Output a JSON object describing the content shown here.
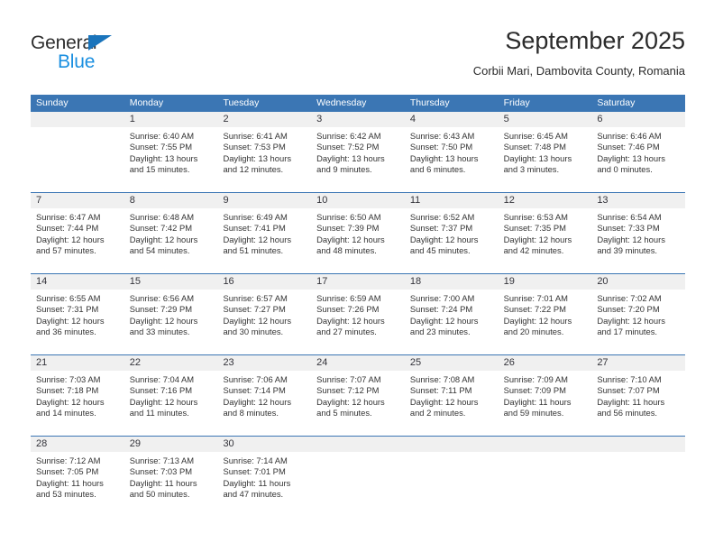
{
  "brand": {
    "name_part1": "General",
    "name_part2": "Blue",
    "color_dark": "#2e2e2e",
    "color_blue": "#1a8fe0",
    "triangle_color": "#1a74bb"
  },
  "header": {
    "title": "September 2025",
    "subtitle": "Corbii Mari, Dambovita County, Romania"
  },
  "theme": {
    "header_row_bg": "#3b76b4",
    "header_row_text": "#ffffff",
    "daynum_band_bg": "#f0f0f0",
    "cell_bg": "#ffffff",
    "text": "#333333"
  },
  "weekdays": [
    "Sunday",
    "Monday",
    "Tuesday",
    "Wednesday",
    "Thursday",
    "Friday",
    "Saturday"
  ],
  "labels": {
    "sunrise_prefix": "Sunrise:",
    "sunset_prefix": "Sunset:",
    "daylight_prefix": "Daylight:"
  },
  "weeks": [
    {
      "days": [
        {
          "num": "",
          "empty": true,
          "l1": "",
          "l2": "",
          "l3": "",
          "l4": ""
        },
        {
          "num": "1",
          "empty": false,
          "l1": "Sunrise: 6:40 AM",
          "l2": "Sunset: 7:55 PM",
          "l3": "Daylight: 13 hours",
          "l4": "and 15 minutes."
        },
        {
          "num": "2",
          "empty": false,
          "l1": "Sunrise: 6:41 AM",
          "l2": "Sunset: 7:53 PM",
          "l3": "Daylight: 13 hours",
          "l4": "and 12 minutes."
        },
        {
          "num": "3",
          "empty": false,
          "l1": "Sunrise: 6:42 AM",
          "l2": "Sunset: 7:52 PM",
          "l3": "Daylight: 13 hours",
          "l4": "and 9 minutes."
        },
        {
          "num": "4",
          "empty": false,
          "l1": "Sunrise: 6:43 AM",
          "l2": "Sunset: 7:50 PM",
          "l3": "Daylight: 13 hours",
          "l4": "and 6 minutes."
        },
        {
          "num": "5",
          "empty": false,
          "l1": "Sunrise: 6:45 AM",
          "l2": "Sunset: 7:48 PM",
          "l3": "Daylight: 13 hours",
          "l4": "and 3 minutes."
        },
        {
          "num": "6",
          "empty": false,
          "l1": "Sunrise: 6:46 AM",
          "l2": "Sunset: 7:46 PM",
          "l3": "Daylight: 13 hours",
          "l4": "and 0 minutes."
        }
      ]
    },
    {
      "days": [
        {
          "num": "7",
          "empty": false,
          "l1": "Sunrise: 6:47 AM",
          "l2": "Sunset: 7:44 PM",
          "l3": "Daylight: 12 hours",
          "l4": "and 57 minutes."
        },
        {
          "num": "8",
          "empty": false,
          "l1": "Sunrise: 6:48 AM",
          "l2": "Sunset: 7:42 PM",
          "l3": "Daylight: 12 hours",
          "l4": "and 54 minutes."
        },
        {
          "num": "9",
          "empty": false,
          "l1": "Sunrise: 6:49 AM",
          "l2": "Sunset: 7:41 PM",
          "l3": "Daylight: 12 hours",
          "l4": "and 51 minutes."
        },
        {
          "num": "10",
          "empty": false,
          "l1": "Sunrise: 6:50 AM",
          "l2": "Sunset: 7:39 PM",
          "l3": "Daylight: 12 hours",
          "l4": "and 48 minutes."
        },
        {
          "num": "11",
          "empty": false,
          "l1": "Sunrise: 6:52 AM",
          "l2": "Sunset: 7:37 PM",
          "l3": "Daylight: 12 hours",
          "l4": "and 45 minutes."
        },
        {
          "num": "12",
          "empty": false,
          "l1": "Sunrise: 6:53 AM",
          "l2": "Sunset: 7:35 PM",
          "l3": "Daylight: 12 hours",
          "l4": "and 42 minutes."
        },
        {
          "num": "13",
          "empty": false,
          "l1": "Sunrise: 6:54 AM",
          "l2": "Sunset: 7:33 PM",
          "l3": "Daylight: 12 hours",
          "l4": "and 39 minutes."
        }
      ]
    },
    {
      "days": [
        {
          "num": "14",
          "empty": false,
          "l1": "Sunrise: 6:55 AM",
          "l2": "Sunset: 7:31 PM",
          "l3": "Daylight: 12 hours",
          "l4": "and 36 minutes."
        },
        {
          "num": "15",
          "empty": false,
          "l1": "Sunrise: 6:56 AM",
          "l2": "Sunset: 7:29 PM",
          "l3": "Daylight: 12 hours",
          "l4": "and 33 minutes."
        },
        {
          "num": "16",
          "empty": false,
          "l1": "Sunrise: 6:57 AM",
          "l2": "Sunset: 7:27 PM",
          "l3": "Daylight: 12 hours",
          "l4": "and 30 minutes."
        },
        {
          "num": "17",
          "empty": false,
          "l1": "Sunrise: 6:59 AM",
          "l2": "Sunset: 7:26 PM",
          "l3": "Daylight: 12 hours",
          "l4": "and 27 minutes."
        },
        {
          "num": "18",
          "empty": false,
          "l1": "Sunrise: 7:00 AM",
          "l2": "Sunset: 7:24 PM",
          "l3": "Daylight: 12 hours",
          "l4": "and 23 minutes."
        },
        {
          "num": "19",
          "empty": false,
          "l1": "Sunrise: 7:01 AM",
          "l2": "Sunset: 7:22 PM",
          "l3": "Daylight: 12 hours",
          "l4": "and 20 minutes."
        },
        {
          "num": "20",
          "empty": false,
          "l1": "Sunrise: 7:02 AM",
          "l2": "Sunset: 7:20 PM",
          "l3": "Daylight: 12 hours",
          "l4": "and 17 minutes."
        }
      ]
    },
    {
      "days": [
        {
          "num": "21",
          "empty": false,
          "l1": "Sunrise: 7:03 AM",
          "l2": "Sunset: 7:18 PM",
          "l3": "Daylight: 12 hours",
          "l4": "and 14 minutes."
        },
        {
          "num": "22",
          "empty": false,
          "l1": "Sunrise: 7:04 AM",
          "l2": "Sunset: 7:16 PM",
          "l3": "Daylight: 12 hours",
          "l4": "and 11 minutes."
        },
        {
          "num": "23",
          "empty": false,
          "l1": "Sunrise: 7:06 AM",
          "l2": "Sunset: 7:14 PM",
          "l3": "Daylight: 12 hours",
          "l4": "and 8 minutes."
        },
        {
          "num": "24",
          "empty": false,
          "l1": "Sunrise: 7:07 AM",
          "l2": "Sunset: 7:12 PM",
          "l3": "Daylight: 12 hours",
          "l4": "and 5 minutes."
        },
        {
          "num": "25",
          "empty": false,
          "l1": "Sunrise: 7:08 AM",
          "l2": "Sunset: 7:11 PM",
          "l3": "Daylight: 12 hours",
          "l4": "and 2 minutes."
        },
        {
          "num": "26",
          "empty": false,
          "l1": "Sunrise: 7:09 AM",
          "l2": "Sunset: 7:09 PM",
          "l3": "Daylight: 11 hours",
          "l4": "and 59 minutes."
        },
        {
          "num": "27",
          "empty": false,
          "l1": "Sunrise: 7:10 AM",
          "l2": "Sunset: 7:07 PM",
          "l3": "Daylight: 11 hours",
          "l4": "and 56 minutes."
        }
      ]
    },
    {
      "days": [
        {
          "num": "28",
          "empty": false,
          "l1": "Sunrise: 7:12 AM",
          "l2": "Sunset: 7:05 PM",
          "l3": "Daylight: 11 hours",
          "l4": "and 53 minutes."
        },
        {
          "num": "29",
          "empty": false,
          "l1": "Sunrise: 7:13 AM",
          "l2": "Sunset: 7:03 PM",
          "l3": "Daylight: 11 hours",
          "l4": "and 50 minutes."
        },
        {
          "num": "30",
          "empty": false,
          "l1": "Sunrise: 7:14 AM",
          "l2": "Sunset: 7:01 PM",
          "l3": "Daylight: 11 hours",
          "l4": "and 47 minutes."
        },
        {
          "num": "",
          "empty": true,
          "l1": "",
          "l2": "",
          "l3": "",
          "l4": ""
        },
        {
          "num": "",
          "empty": true,
          "l1": "",
          "l2": "",
          "l3": "",
          "l4": ""
        },
        {
          "num": "",
          "empty": true,
          "l1": "",
          "l2": "",
          "l3": "",
          "l4": ""
        },
        {
          "num": "",
          "empty": true,
          "l1": "",
          "l2": "",
          "l3": "",
          "l4": ""
        }
      ]
    }
  ]
}
